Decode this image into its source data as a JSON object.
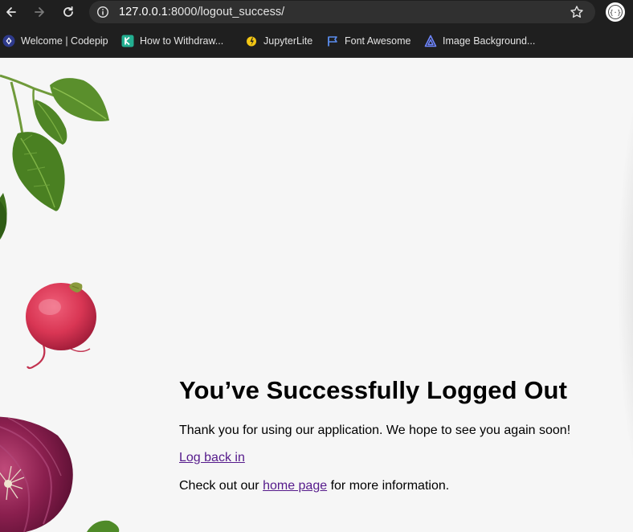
{
  "browser": {
    "url_host": "127.0.0.1",
    "url_rest": ":8000/logout_success/",
    "bookmarks": [
      {
        "label": "Welcome | Codepip",
        "icon": "codepip-icon"
      },
      {
        "label": "How to Withdraw...",
        "icon": "kucoin-icon"
      },
      {
        "label": "JupyterLite",
        "icon": "jupyterlite-icon"
      },
      {
        "label": "Font Awesome",
        "icon": "flag-icon"
      },
      {
        "label": "Image Background...",
        "icon": "image-bg-icon"
      }
    ],
    "colors": {
      "chrome": "#1f1f1f",
      "omnibox": "#303030"
    }
  },
  "page": {
    "heading": "You’ve Successfully Logged Out",
    "thank_you": "Thank you for using our application. We hope to see you again soon!",
    "login_link": "Log back in",
    "check_prefix": "Check out our",
    "home_link": "home page",
    "check_suffix": "for more information.",
    "colors": {
      "background": "#f6f6f6",
      "link": "#551a8b"
    }
  }
}
